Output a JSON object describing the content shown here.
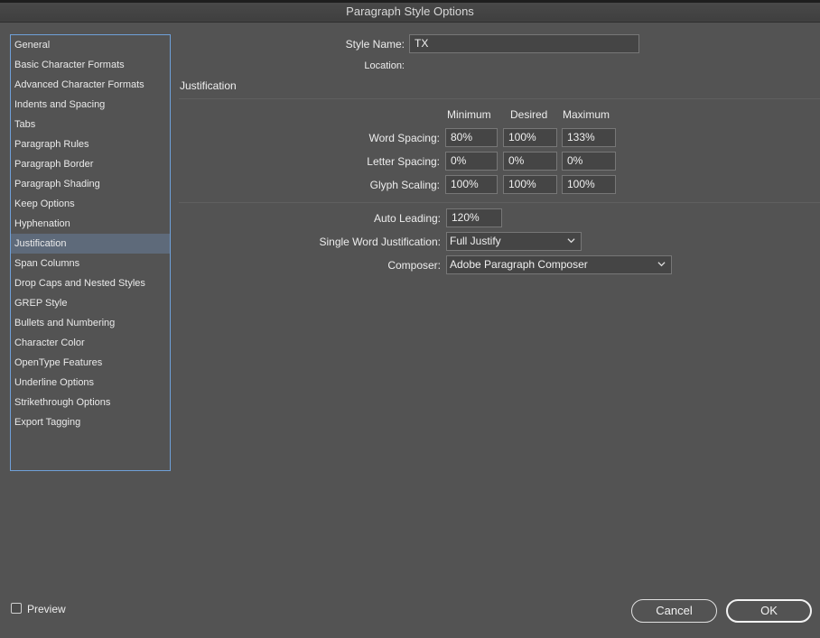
{
  "window": {
    "title": "Paragraph Style Options"
  },
  "sidebar": {
    "items": [
      {
        "label": "General"
      },
      {
        "label": "Basic Character Formats"
      },
      {
        "label": "Advanced Character Formats"
      },
      {
        "label": "Indents and Spacing"
      },
      {
        "label": "Tabs"
      },
      {
        "label": "Paragraph Rules"
      },
      {
        "label": "Paragraph Border"
      },
      {
        "label": "Paragraph Shading"
      },
      {
        "label": "Keep Options"
      },
      {
        "label": "Hyphenation"
      },
      {
        "label": "Justification",
        "selected": true
      },
      {
        "label": "Span Columns"
      },
      {
        "label": "Drop Caps and Nested Styles"
      },
      {
        "label": "GREP Style"
      },
      {
        "label": "Bullets and Numbering"
      },
      {
        "label": "Character Color"
      },
      {
        "label": "OpenType Features"
      },
      {
        "label": "Underline Options"
      },
      {
        "label": "Strikethrough Options"
      },
      {
        "label": "Export Tagging"
      }
    ]
  },
  "header": {
    "style_name_label": "Style Name:",
    "style_name_value": "TX",
    "location_label": "Location:"
  },
  "justification": {
    "section_title": "Justification",
    "columns": {
      "minimum": "Minimum",
      "desired": "Desired",
      "maximum": "Maximum"
    },
    "rows": [
      {
        "label": "Word Spacing:",
        "minimum": "80%",
        "desired": "100%",
        "maximum": "133%"
      },
      {
        "label": "Letter Spacing:",
        "minimum": "0%",
        "desired": "0%",
        "maximum": "0%"
      },
      {
        "label": "Glyph Scaling:",
        "minimum": "100%",
        "desired": "100%",
        "maximum": "100%"
      }
    ],
    "auto_leading_label": "Auto Leading:",
    "auto_leading_value": "120%",
    "single_word_label": "Single Word Justification:",
    "single_word_value": "Full Justify",
    "composer_label": "Composer:",
    "composer_value": "Adobe Paragraph Composer"
  },
  "footer": {
    "preview_label": "Preview",
    "preview_checked": false,
    "cancel_label": "Cancel",
    "ok_label": "OK"
  },
  "colors": {
    "background": "#535353",
    "selected_item": "#5e6a7a",
    "list_border": "#6fa0d8"
  }
}
